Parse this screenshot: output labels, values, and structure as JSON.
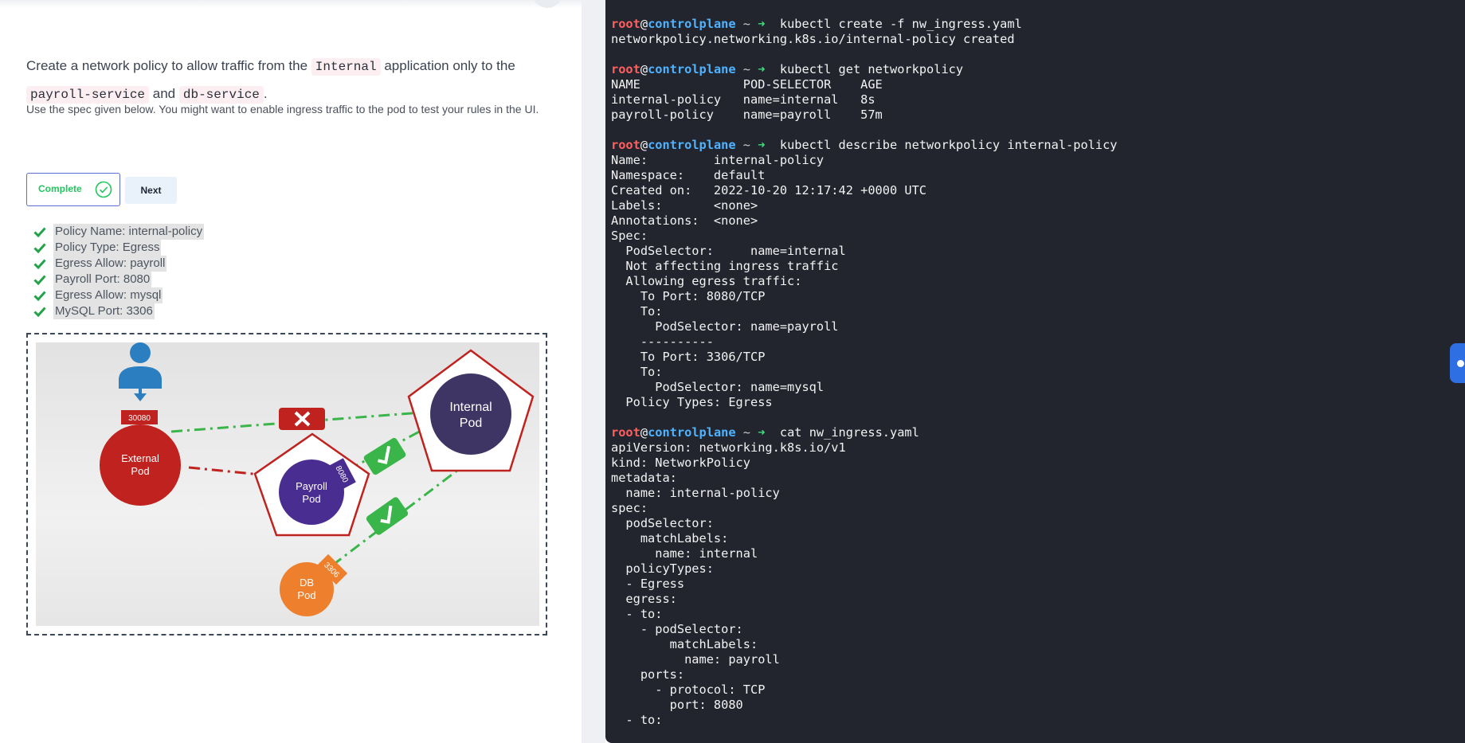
{
  "task": {
    "line1_pre": "Create a network policy to allow traffic from the",
    "app_name": "Internal",
    "line1_post": "application only to the",
    "service1": "payroll-service",
    "and_word": "and",
    "service2": "db-service",
    "period": ".",
    "subtext": "Use the spec given below. You might want to enable ingress traffic to the pod to test your rules in the UI."
  },
  "buttons": {
    "complete": "Complete",
    "next": "Next"
  },
  "checklist": [
    "Policy Name: internal-policy",
    "Policy Type: Egress",
    "Egress Allow: payroll",
    "Payroll Port: 8080",
    "Egress Allow: mysql",
    "MySQL Port: 3306"
  ],
  "diagram": {
    "user_port": "30080",
    "external_pod": [
      "External",
      "Pod"
    ],
    "payroll_pod": [
      "Payroll",
      "Pod"
    ],
    "internal_pod": [
      "Internal",
      "Pod"
    ],
    "db_pod": [
      "DB",
      "Pod"
    ],
    "payroll_port": "8080",
    "db_port": "3306",
    "colors": {
      "external": "#c0231f",
      "payroll": "#4a2d91",
      "internal": "#3e3564",
      "db": "#ee7f2d",
      "allow": "#3ab54a",
      "deny": "#c0231f",
      "user": "#2b7fc1"
    }
  },
  "terminal": {
    "user": "root",
    "host": "controlplane",
    "cwd": "~",
    "prompt_arrow": "➜",
    "lines": [
      {
        "t": "p",
        "cmd": "kubectl create -f nw_ingress.yaml"
      },
      {
        "t": "o",
        "text": "networkpolicy.networking.k8s.io/internal-policy created"
      },
      {
        "t": "o",
        "text": ""
      },
      {
        "t": "p",
        "cmd": "kubectl get networkpolicy"
      },
      {
        "t": "o",
        "text": "NAME              POD-SELECTOR    AGE"
      },
      {
        "t": "o",
        "text": "internal-policy   name=internal   8s"
      },
      {
        "t": "o",
        "text": "payroll-policy    name=payroll    57m"
      },
      {
        "t": "o",
        "text": ""
      },
      {
        "t": "p",
        "cmd": "kubectl describe networkpolicy internal-policy"
      },
      {
        "t": "o",
        "text": "Name:         internal-policy"
      },
      {
        "t": "o",
        "text": "Namespace:    default"
      },
      {
        "t": "o",
        "text": "Created on:   2022-10-20 12:17:42 +0000 UTC"
      },
      {
        "t": "o",
        "text": "Labels:       <none>"
      },
      {
        "t": "o",
        "text": "Annotations:  <none>"
      },
      {
        "t": "o",
        "text": "Spec:"
      },
      {
        "t": "o",
        "text": "  PodSelector:     name=internal"
      },
      {
        "t": "o",
        "text": "  Not affecting ingress traffic"
      },
      {
        "t": "o",
        "text": "  Allowing egress traffic:"
      },
      {
        "t": "o",
        "text": "    To Port: 8080/TCP"
      },
      {
        "t": "o",
        "text": "    To:"
      },
      {
        "t": "o",
        "text": "      PodSelector: name=payroll"
      },
      {
        "t": "o",
        "text": "    ----------"
      },
      {
        "t": "o",
        "text": "    To Port: 3306/TCP"
      },
      {
        "t": "o",
        "text": "    To:"
      },
      {
        "t": "o",
        "text": "      PodSelector: name=mysql"
      },
      {
        "t": "o",
        "text": "  Policy Types: Egress"
      },
      {
        "t": "o",
        "text": ""
      },
      {
        "t": "p",
        "cmd": "cat nw_ingress.yaml"
      },
      {
        "t": "o",
        "text": "apiVersion: networking.k8s.io/v1"
      },
      {
        "t": "o",
        "text": "kind: NetworkPolicy"
      },
      {
        "t": "o",
        "text": "metadata:"
      },
      {
        "t": "o",
        "text": "  name: internal-policy"
      },
      {
        "t": "o",
        "text": "spec:"
      },
      {
        "t": "o",
        "text": "  podSelector:"
      },
      {
        "t": "o",
        "text": "    matchLabels:"
      },
      {
        "t": "o",
        "text": "      name: internal"
      },
      {
        "t": "o",
        "text": "  policyTypes:"
      },
      {
        "t": "o",
        "text": "  - Egress"
      },
      {
        "t": "o",
        "text": "  egress:"
      },
      {
        "t": "o",
        "text": "  - to:"
      },
      {
        "t": "o",
        "text": "    - podSelector:"
      },
      {
        "t": "o",
        "text": "        matchLabels:"
      },
      {
        "t": "o",
        "text": "          name: payroll"
      },
      {
        "t": "o",
        "text": "    ports:"
      },
      {
        "t": "o",
        "text": "      - protocol: TCP"
      },
      {
        "t": "o",
        "text": "        port: 8080"
      },
      {
        "t": "o",
        "text": "  - to:"
      }
    ]
  }
}
